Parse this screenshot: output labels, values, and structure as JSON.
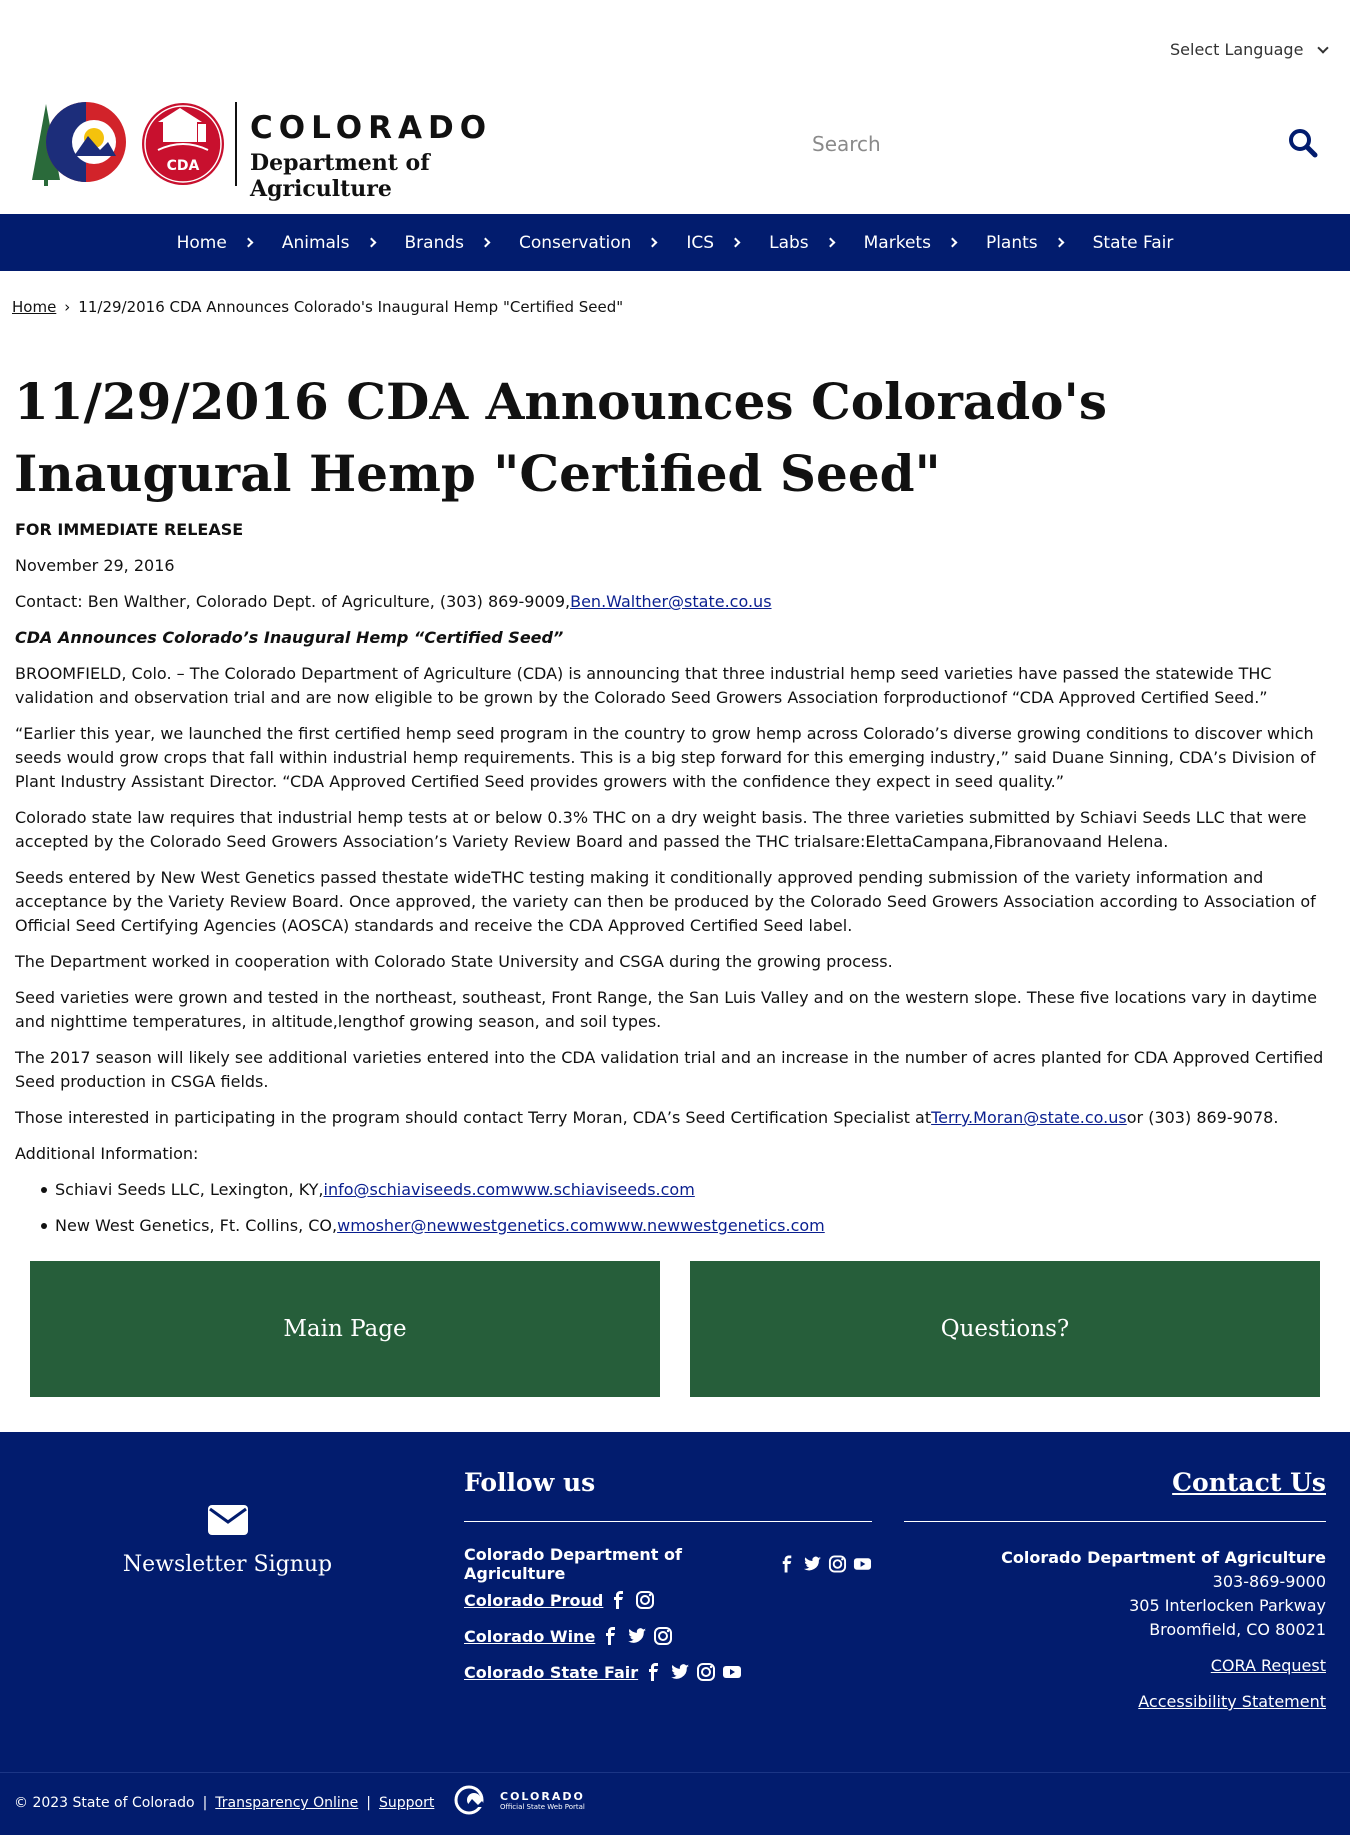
{
  "header": {
    "language_label": "Select Language",
    "logo_line1": "COLORADO",
    "logo_line2": "Department of Agriculture",
    "logo_badge": "CDA",
    "search_placeholder": "Search"
  },
  "nav": {
    "items": [
      "Home",
      "Animals",
      "Brands",
      "Conservation",
      "ICS",
      "Labs",
      "Markets",
      "Plants",
      "State Fair"
    ]
  },
  "breadcrumb": {
    "home": "Home",
    "current": "11/29/2016 CDA Announces Colorado's Inaugural Hemp \"Certified Seed\""
  },
  "article": {
    "title": "11/29/2016 CDA Announces Colorado's Inaugural Hemp \"Certified Seed\"",
    "release": "FOR IMMEDIATE RELEASE",
    "date": "November 29, 2016",
    "contact_prefix": "Contact: Ben Walther, Colorado Dept. of Agriculture, (303) 869-9009,",
    "contact_email": "Ben.Walther@state.co.us",
    "headline": "CDA Announces Colorado’s Inaugural Hemp “Certified Seed”",
    "p1": "BROOMFIELD, Colo. – The Colorado Department of Agriculture (CDA) is announcing that three industrial hemp seed varieties have passed the statewide THC validation and observation trial and are now eligible to be grown by the Colorado Seed Growers Association forproductionof “CDA Approved Certified Seed.”",
    "p2": "“Earlier this year, we launched the first certified hemp seed program in the country to grow hemp across Colorado’s diverse growing conditions to discover which seeds would grow crops that fall within industrial hemp requirements. This is a big step forward for this emerging industry,” said Duane Sinning, CDA’s Division of Plant Industry Assistant Director. “CDA Approved Certified Seed provides growers with the confidence they expect in seed quality.”",
    "p3": "Colorado state law requires that industrial hemp tests at or below 0.3% THC on a dry weight basis. The three varieties submitted by Schiavi Seeds LLC that were accepted by the Colorado Seed Growers Association’s Variety Review Board and passed the THC trialsare:ElettaCampana,Fibranovaand Helena.",
    "p4": "Seeds entered by New West Genetics passed thestate wideTHC testing making it conditionally approved pending submission of the variety information and acceptance by the Variety Review Board. Once approved, the variety can then be produced by the Colorado Seed Growers Association according to Association of Official Seed Certifying Agencies (AOSCA) standards and receive the CDA Approved Certified Seed label.",
    "p5": "The Department worked in cooperation with Colorado State University and CSGA during the growing process.",
    "p6": "Seed varieties were grown and tested in the northeast, southeast, Front Range, the San Luis Valley and on the western slope. These five locations vary in daytime and nighttime temperatures, in altitude,lengthof growing season, and soil types.",
    "p7": "The 2017 season will likely see additional varieties entered into the CDA validation trial and an increase in the number of acres planted for CDA Approved Certified Seed production in CSGA fields.",
    "p8_prefix": "Those interested in participating in the program should contact Terry Moran, CDA’s Seed Certification Specialist at",
    "p8_email": "Terry.Moran@state.co.us",
    "p8_suffix": "or (303) 869-9078.",
    "additional": "Additional Information:",
    "li1_prefix": "Schiavi Seeds LLC, Lexington, KY,",
    "li1_link": "info@schiaviseeds.comwww.schiaviseeds.com",
    "li2_prefix": "New West Genetics, Ft. Collins, CO,",
    "li2_link": "wmosher@newwestgenetics.comwww.newwestgenetics.com"
  },
  "cta": {
    "main": "Main Page",
    "questions": "Questions?"
  },
  "footer": {
    "newsletter": "Newsletter Signup",
    "follow_title": "Follow us",
    "follow_rows": [
      {
        "label": "Colorado Department of Agriculture",
        "icons": [
          "facebook-icon",
          "twitter-icon",
          "instagram-icon",
          "youtube-icon"
        ]
      },
      {
        "label": "Colorado Proud",
        "icons": [
          "facebook-icon",
          "instagram-icon"
        ]
      },
      {
        "label": "Colorado Wine",
        "icons": [
          "facebook-icon",
          "twitter-icon",
          "instagram-icon"
        ]
      },
      {
        "label": "Colorado State Fair",
        "icons": [
          "facebook-icon",
          "twitter-icon",
          "instagram-icon",
          "youtube-icon"
        ]
      }
    ],
    "contact_title": "Contact Us",
    "org": "Colorado Department of Agriculture",
    "phone": "303-869-9000",
    "street": "305 Interlocken Parkway",
    "city": "Broomfield, CO 80021",
    "cora": "CORA Request",
    "accessibility": "Accessibility Statement"
  },
  "bottom": {
    "copyright": "© 2023 State of Colorado",
    "sep": "|",
    "transparency": "Transparency Online",
    "support": "Support",
    "portal_line1": "COLORADO",
    "portal_line2": "Official State Web Portal"
  },
  "colors": {
    "navy": "#021c6e",
    "green": "#265e3a",
    "link": "#0a1f8f"
  }
}
